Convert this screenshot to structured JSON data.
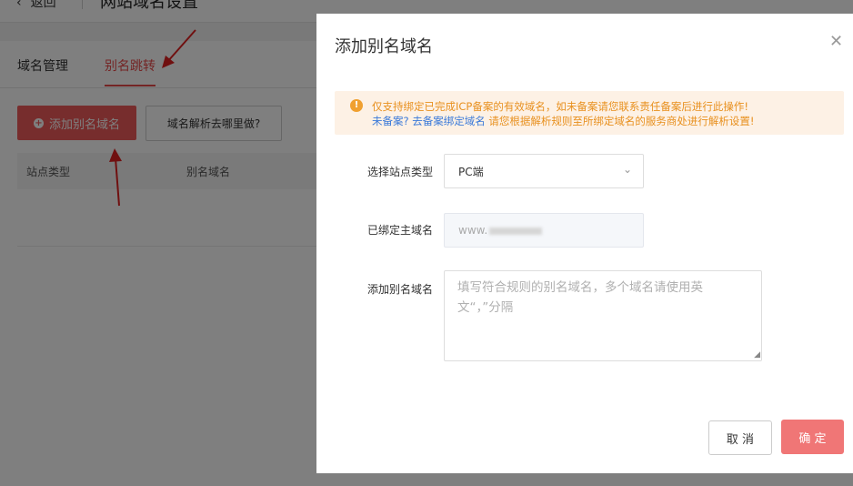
{
  "background": {
    "back_label": "返回",
    "page_title": "网站域名设置",
    "tabs": [
      {
        "label": "域名管理"
      },
      {
        "label": "别名跳转"
      }
    ],
    "add_alias_button": "添加别名域名",
    "dns_help_button": "域名解析去哪里做?",
    "table_headers": [
      "站点类型",
      "别名域名"
    ]
  },
  "modal": {
    "title": "添加别名域名",
    "notice": {
      "line1": "仅支持绑定已完成ICP备案的有效域名，如未备案请您联系责任备案后进行此操作!",
      "link1": "未备案?",
      "link2": "去备案",
      "link3": "绑定域名",
      "line2_rest": "请您根据解析规则至所绑定域名的服务商处进行解析设置!"
    },
    "site_type_label": "选择站点类型",
    "site_type_value": "PC端",
    "main_domain_label": "已绑定主域名",
    "main_domain_value": "www.",
    "alias_label": "添加别名域名",
    "alias_placeholder": "填写符合规则的别名域名，多个域名请使用英文“，”分隔",
    "cancel_button": "取 消",
    "ok_button": "确 定"
  },
  "colors": {
    "accent": "#ef5a5a",
    "notice_bg": "#fdf1e5",
    "notice_text": "#e8901e",
    "link": "#3b7ad9"
  }
}
